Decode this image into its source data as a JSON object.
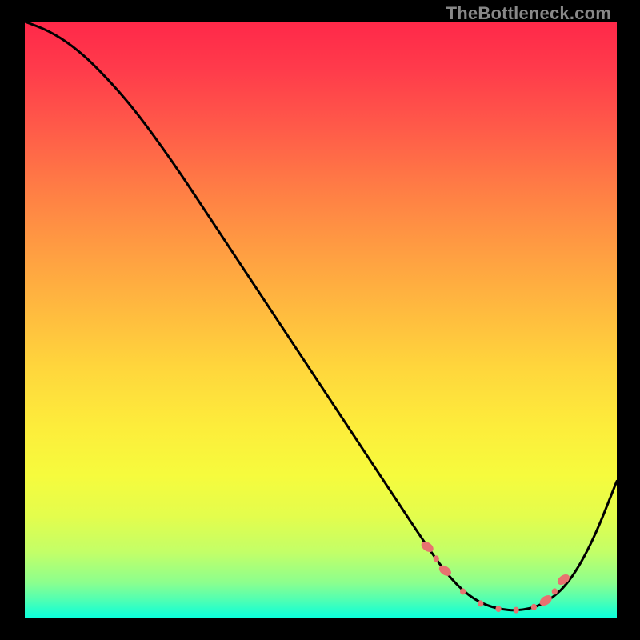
{
  "watermark": "TheBottleneck.com",
  "colors": {
    "marker": "#e77270",
    "curve": "#000000"
  },
  "chart_data": {
    "type": "line",
    "title": "",
    "xlabel": "",
    "ylabel": "",
    "xlim": [
      0,
      100
    ],
    "ylim": [
      0,
      100
    ],
    "grid": false,
    "legend": false,
    "series": [
      {
        "name": "bottleneck-curve",
        "x": [
          0,
          4,
          8,
          12,
          18,
          25,
          32,
          40,
          48,
          55,
          62,
          68,
          72,
          76,
          80,
          84,
          88,
          92,
          96,
          100
        ],
        "y": [
          100,
          98.5,
          96,
          92.5,
          86,
          76.5,
          66,
          54,
          42,
          31.5,
          21,
          12,
          6.5,
          3,
          1.5,
          1.3,
          2.5,
          6,
          13,
          23
        ]
      }
    ],
    "markers": {
      "name": "trough-dots",
      "x": [
        68,
        69.5,
        71,
        74,
        77,
        80,
        83,
        86,
        88,
        89.5,
        91
      ],
      "y": [
        12,
        10,
        8,
        4.5,
        2.5,
        1.6,
        1.4,
        1.9,
        3.0,
        4.5,
        6.5
      ],
      "sizes": [
        6,
        4,
        6,
        4,
        4,
        4,
        4,
        4,
        6,
        4,
        6
      ]
    }
  }
}
